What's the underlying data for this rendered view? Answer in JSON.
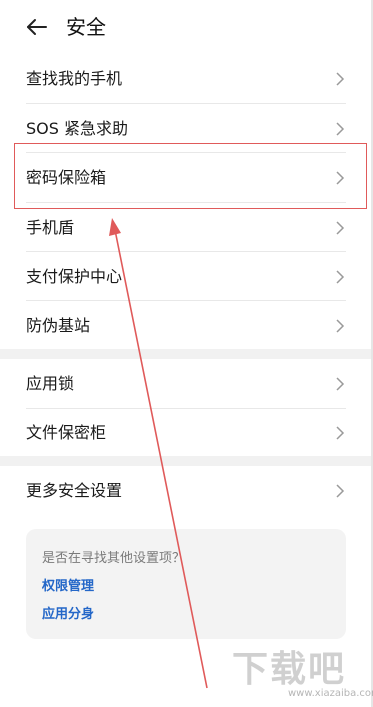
{
  "header": {
    "title": "安全"
  },
  "menu": {
    "items": [
      {
        "label": "查找我的手机"
      },
      {
        "label": "SOS 紧急求助"
      },
      {
        "label": "密码保险箱"
      },
      {
        "label": "手机盾"
      },
      {
        "label": "支付保护中心"
      },
      {
        "label": "防伪基站"
      },
      {
        "label": "应用锁"
      },
      {
        "label": "文件保密柜"
      },
      {
        "label": "更多安全设置"
      }
    ]
  },
  "suggest": {
    "question": "是否在寻找其他设置项？",
    "links": [
      "权限管理",
      "应用分身"
    ]
  },
  "watermark": {
    "text": "下载吧",
    "url": "www.xiazaiba.com"
  },
  "colors": {
    "annotation_red": "#e05a5a",
    "link_blue": "#2467c8"
  },
  "icons": {
    "back": "arrow-left-icon",
    "chevron": "chevron-right-icon"
  }
}
